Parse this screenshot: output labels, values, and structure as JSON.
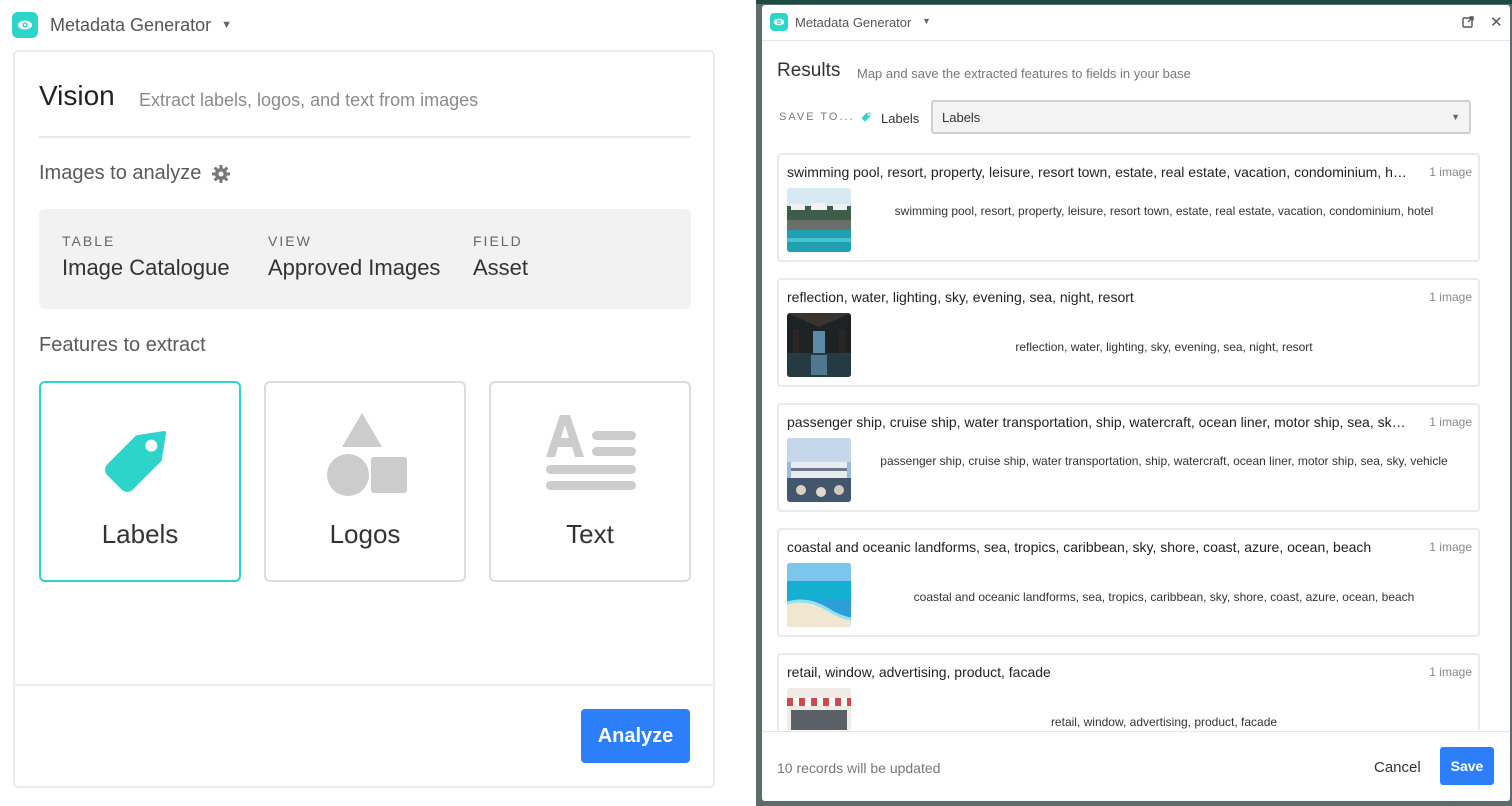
{
  "left": {
    "app_title": "Metadata Generator",
    "vision_title": "Vision",
    "vision_subtitle": "Extract labels, logos, and text from images",
    "images_heading": "Images to analyze",
    "source": {
      "table_label": "TABLE",
      "table_value": "Image Catalogue",
      "view_label": "VIEW",
      "view_value": "Approved Images",
      "field_label": "FIELD",
      "field_value": "Asset"
    },
    "features_heading": "Features to extract",
    "features": [
      "Labels",
      "Logos",
      "Text"
    ],
    "selected_feature": "Labels",
    "analyze_label": "Analyze"
  },
  "right": {
    "app_title": "Metadata Generator",
    "results_title": "Results",
    "results_subtitle": "Map and save the extracted features to fields in your base",
    "save_to_label": "SAVE TO...",
    "save_to_tag": "Labels",
    "select_value": "Labels",
    "rows": [
      {
        "title": "swimming pool, resort, property, leisure, resort town, estate, real estate, vacation, condominium, hotel",
        "count": "1 image",
        "desc": "swimming pool, resort, property, leisure, resort town, estate, real estate, vacation, condominium, hotel"
      },
      {
        "title": "reflection, water, lighting, sky, evening, sea, night, resort",
        "count": "1 image",
        "desc": "reflection, water, lighting, sky, evening, sea, night, resort"
      },
      {
        "title": "passenger ship, cruise ship, water transportation, ship, watercraft, ocean liner, motor ship, sea, sky, vehicle",
        "count": "1 image",
        "desc": "passenger ship, cruise ship, water transportation, ship, watercraft, ocean liner, motor ship, sea, sky, vehicle"
      },
      {
        "title": "coastal and oceanic landforms, sea, tropics, caribbean, sky, shore, coast, azure, ocean, beach",
        "count": "1 image",
        "desc": "coastal and oceanic landforms, sea, tropics, caribbean, sky, shore, coast, azure, ocean, beach"
      },
      {
        "title": "retail, window, advertising, product, facade",
        "count": "1 image",
        "desc": "retail, window, advertising, product, facade"
      }
    ],
    "footer_info": "10 records will be updated",
    "cancel_label": "Cancel",
    "save_label": "Save"
  },
  "colors": {
    "accent_teal": "#2dd4c9",
    "primary_blue": "#2d7ff9",
    "backdrop": "#5e6b6b"
  },
  "icons": [
    "eye-icon",
    "chevron-down-icon",
    "gear-icon",
    "tag-icon",
    "shapes-icon",
    "text-icon",
    "expand-icon",
    "close-icon"
  ]
}
